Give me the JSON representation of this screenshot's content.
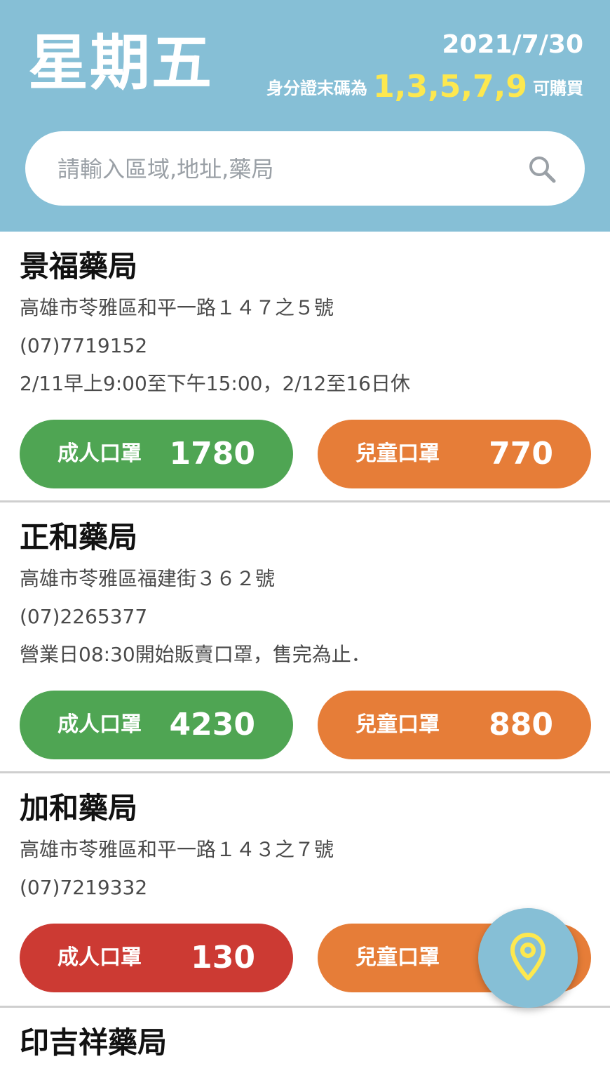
{
  "header": {
    "weekday": "星期五",
    "date": "2021/7/30",
    "rule_prefix": "身分證末碼為",
    "rule_digits": "1,3,5,7,9",
    "rule_suffix": "可購買"
  },
  "search": {
    "placeholder": "請輸入區域,地址,藥局",
    "icon": "search-icon"
  },
  "colors": {
    "header_bg": "#86bfd6",
    "highlight": "#fde84f",
    "adult_green": "#4fa553",
    "adult_red": "#cc3a33",
    "child_orange": "#e67d38"
  },
  "pharmacies": [
    {
      "name": "景福藥局",
      "address": "高雄市苓雅區和平一路１４７之５號",
      "phone": "(07)7719152",
      "note": "2/11早上9:00至下午15:00，2/12至16日休",
      "adult_label": "成人口罩",
      "adult_count": "1780",
      "child_label": "兒童口罩",
      "child_count": "770"
    },
    {
      "name": "正和藥局",
      "address": "高雄市苓雅區福建街３６２號",
      "phone": "(07)2265377",
      "note": "營業日08:30開始販賣口罩，售完為止．",
      "adult_label": "成人口罩",
      "adult_count": "4230",
      "child_label": "兒童口罩",
      "child_count": "880"
    },
    {
      "name": "加和藥局",
      "address": "高雄市苓雅區和平一路１４３之７號",
      "phone": "(07)7219332",
      "adult_label": "成人口罩",
      "adult_count": "130",
      "child_label": "兒童口罩"
    },
    {
      "name": "印吉祥藥局"
    }
  ],
  "fab": {
    "icon": "map-pin-icon"
  }
}
